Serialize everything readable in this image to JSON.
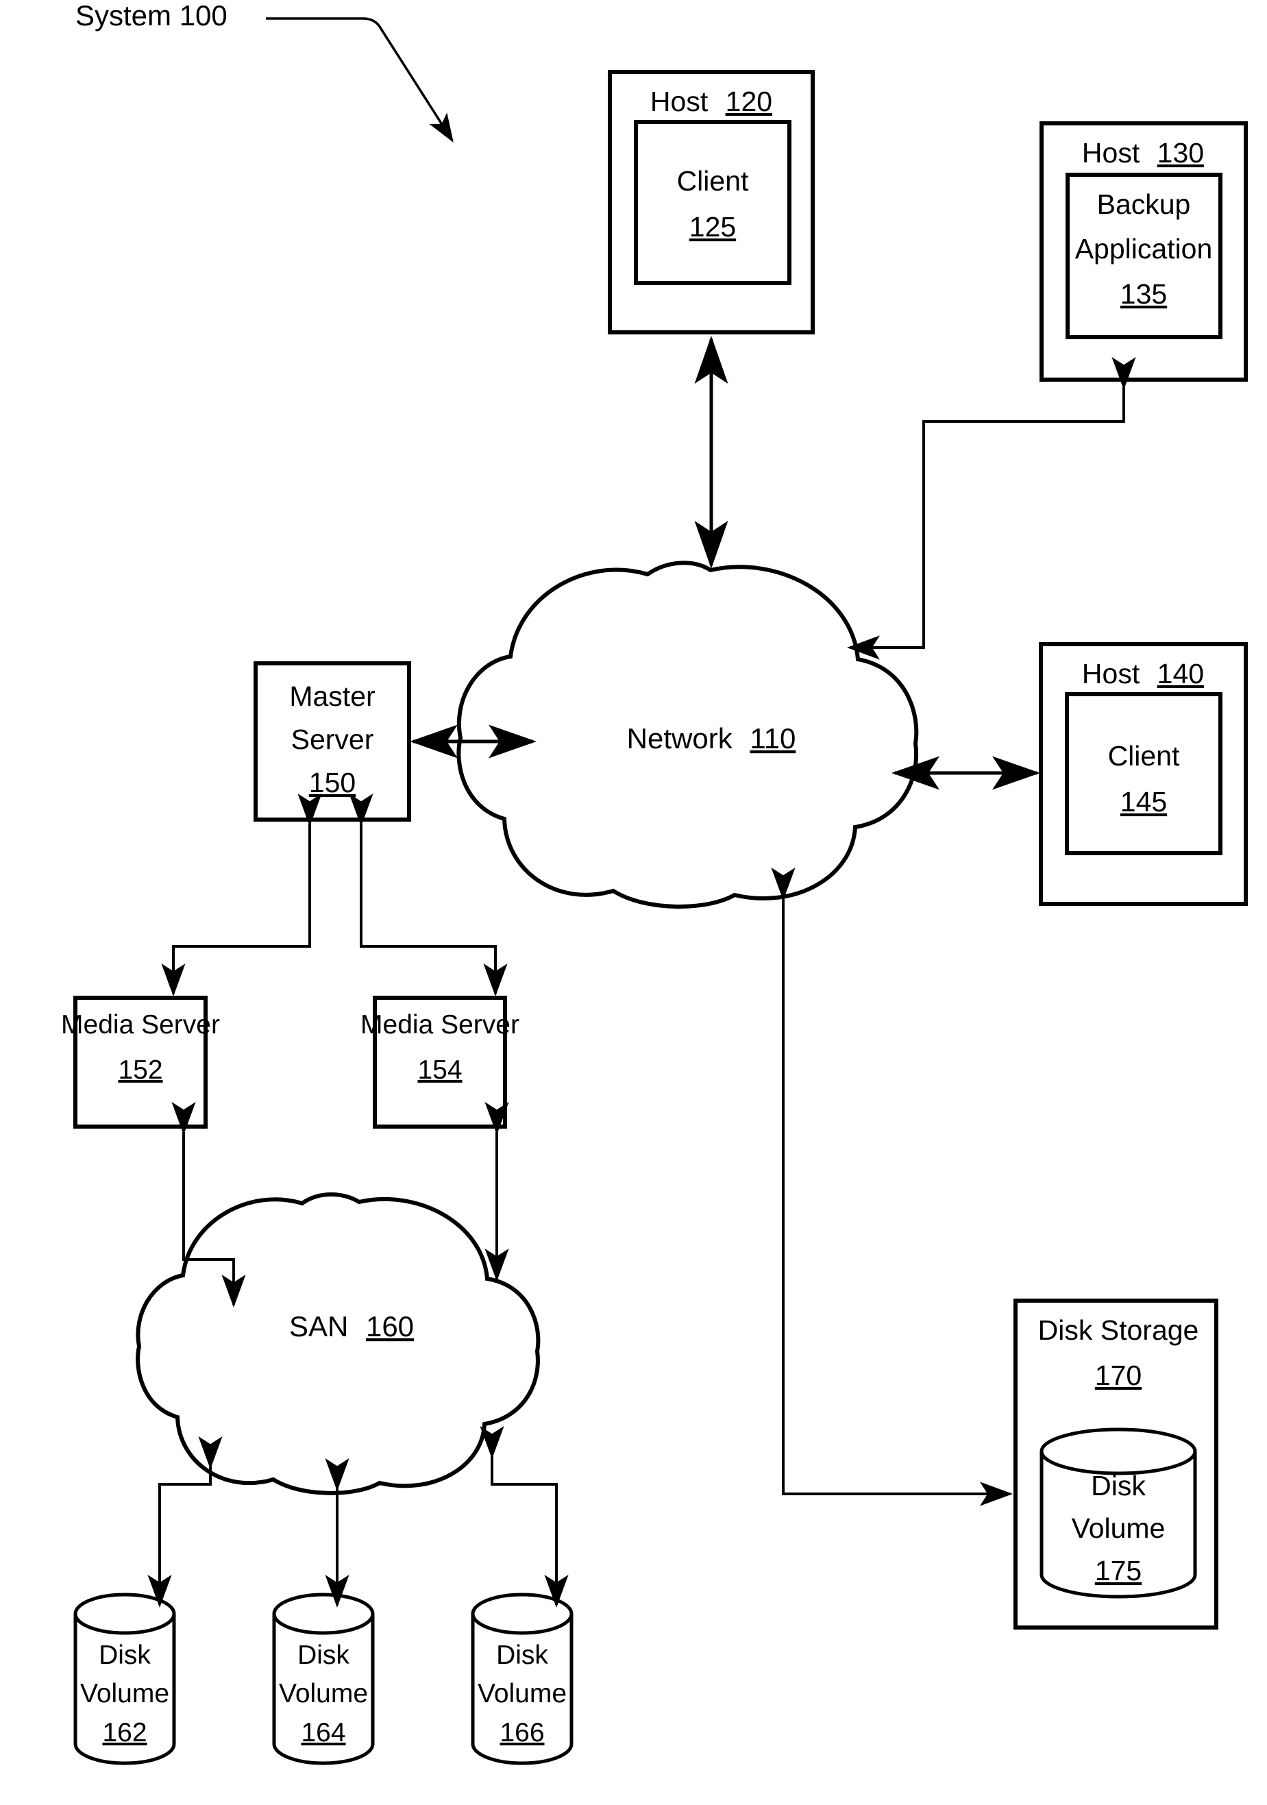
{
  "figure": {
    "title_label": "System 100",
    "domain_kind": "network-backup-architecture-diagram"
  },
  "nodes": {
    "host120": {
      "label": "Host",
      "ref": "120",
      "inner": {
        "label": "Client",
        "ref": "125"
      }
    },
    "host130": {
      "label": "Host",
      "ref": "130",
      "inner": {
        "label_line1": "Backup",
        "label_line2": "Application",
        "ref": "135"
      }
    },
    "host140": {
      "label": "Host",
      "ref": "140",
      "inner": {
        "label": "Client",
        "ref": "145"
      }
    },
    "network": {
      "label": "Network",
      "ref": "110"
    },
    "san": {
      "label": "SAN",
      "ref": "160"
    },
    "master_server": {
      "label_line1": "Master",
      "label_line2": "Server",
      "ref": "150"
    },
    "media_server_152": {
      "label": "Media Server",
      "ref": "152"
    },
    "media_server_154": {
      "label": "Media Server",
      "ref": "154"
    },
    "disk_volume_162": {
      "label_line1": "Disk",
      "label_line2": "Volume",
      "ref": "162"
    },
    "disk_volume_164": {
      "label_line1": "Disk",
      "label_line2": "Volume",
      "ref": "164"
    },
    "disk_volume_166": {
      "label_line1": "Disk",
      "label_line2": "Volume",
      "ref": "166"
    },
    "disk_storage_170": {
      "label_line1": "Disk Storage",
      "ref": "170",
      "inner": {
        "label_line1": "Disk",
        "label_line2": "Volume",
        "ref": "175"
      }
    }
  },
  "colors": {
    "ink": "#000000",
    "paper": "#ffffff"
  }
}
